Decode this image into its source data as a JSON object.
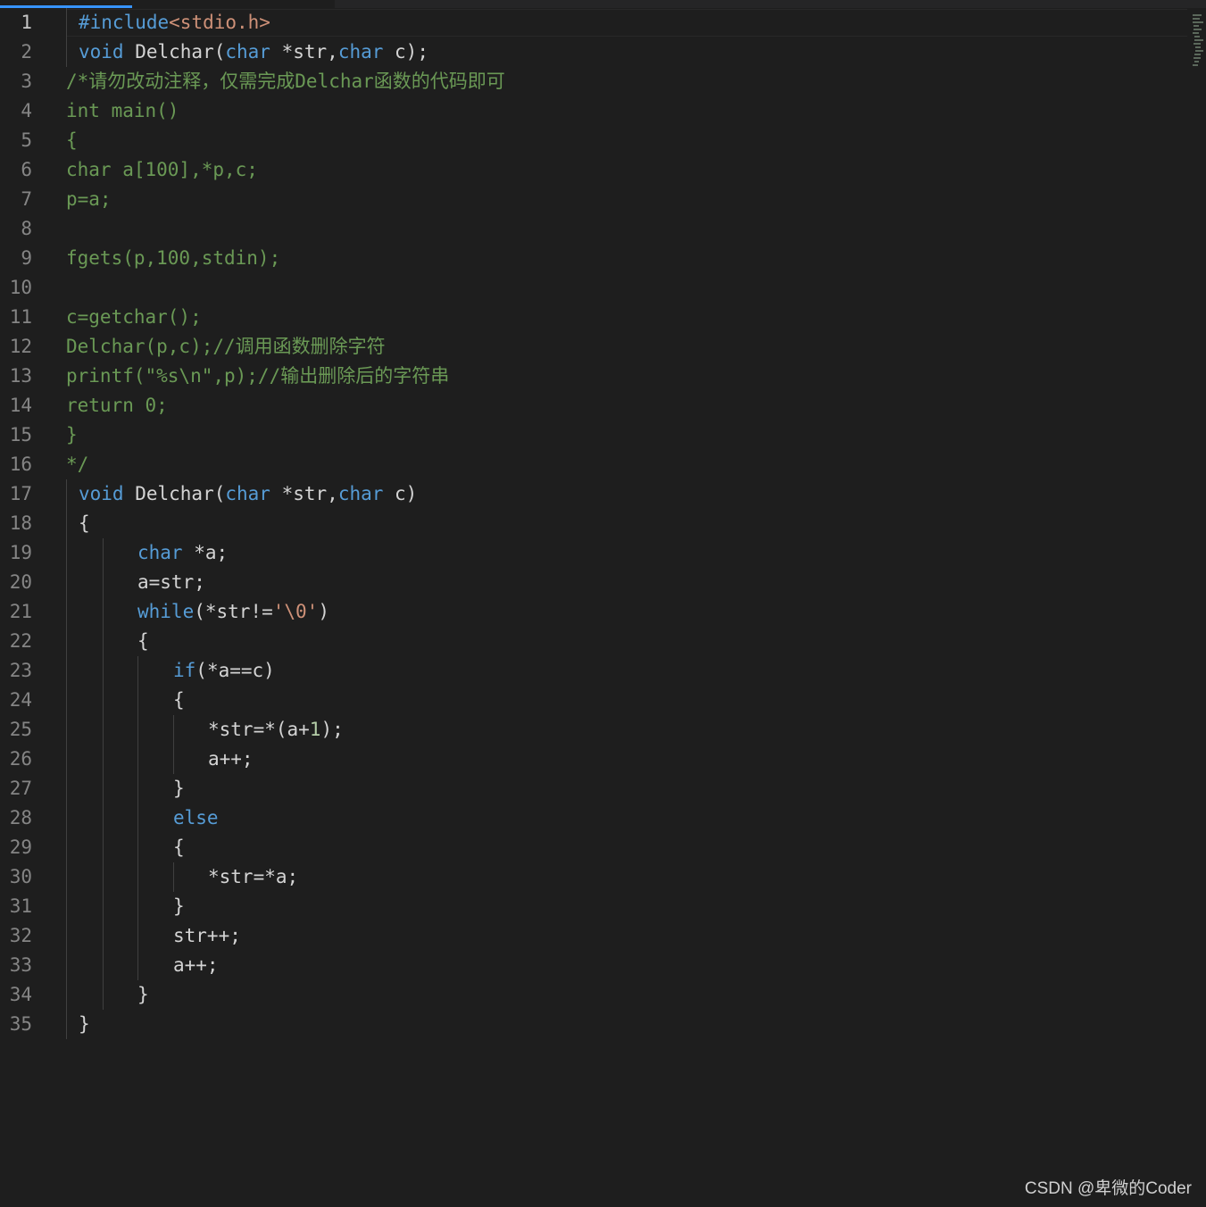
{
  "editor": {
    "active_line": 1,
    "colors": {
      "background": "#1e1e1e",
      "keyword": "#569cd6",
      "string": "#ce9178",
      "number": "#b5cea8",
      "comment": "#6a9955",
      "default": "#d4d4d4",
      "line_number": "#858585"
    },
    "lines": [
      {
        "n": "1",
        "segs": [
          {
            "c": "pp",
            "t": "#include"
          },
          {
            "c": "str",
            "t": "<stdio.h>"
          }
        ]
      },
      {
        "n": "2",
        "segs": [
          {
            "c": "kw",
            "t": "void"
          },
          {
            "c": "",
            "t": " Delchar("
          },
          {
            "c": "kw",
            "t": "char"
          },
          {
            "c": "",
            "t": " *str,"
          },
          {
            "c": "kw",
            "t": "char"
          },
          {
            "c": "",
            "t": " c);"
          }
        ]
      },
      {
        "n": "3",
        "segs": [
          {
            "c": "cm",
            "t": "/*请勿改动注释，仅需完成Delchar函数的代码即可"
          }
        ]
      },
      {
        "n": "4",
        "segs": [
          {
            "c": "cm",
            "t": "int main()"
          }
        ]
      },
      {
        "n": "5",
        "segs": [
          {
            "c": "cm",
            "t": "{"
          }
        ]
      },
      {
        "n": "6",
        "segs": [
          {
            "c": "cm",
            "t": "char a[100],*p,c;"
          }
        ]
      },
      {
        "n": "7",
        "segs": [
          {
            "c": "cm",
            "t": "p=a;"
          }
        ]
      },
      {
        "n": "8",
        "segs": []
      },
      {
        "n": "9",
        "segs": [
          {
            "c": "cm",
            "t": "fgets(p,100,stdin);"
          }
        ]
      },
      {
        "n": "10",
        "segs": []
      },
      {
        "n": "11",
        "segs": [
          {
            "c": "cm",
            "t": "c=getchar();"
          }
        ]
      },
      {
        "n": "12",
        "segs": [
          {
            "c": "cm",
            "t": "Delchar(p,c);//调用函数删除字符"
          }
        ]
      },
      {
        "n": "13",
        "segs": [
          {
            "c": "cm",
            "t": "printf(\"%s\\n\",p);//输出删除后的字符串"
          }
        ]
      },
      {
        "n": "14",
        "segs": [
          {
            "c": "cm",
            "t": "return 0;"
          }
        ]
      },
      {
        "n": "15",
        "segs": [
          {
            "c": "cm",
            "t": "}"
          }
        ]
      },
      {
        "n": "16",
        "segs": [
          {
            "c": "cm",
            "t": "*/"
          }
        ]
      },
      {
        "n": "17",
        "segs": [
          {
            "c": "kw",
            "t": "void"
          },
          {
            "c": "",
            "t": " Delchar("
          },
          {
            "c": "kw",
            "t": "char"
          },
          {
            "c": "",
            "t": " *str,"
          },
          {
            "c": "kw",
            "t": "char"
          },
          {
            "c": "",
            "t": " c)"
          }
        ]
      },
      {
        "n": "18",
        "segs": [
          {
            "c": "",
            "t": "{"
          }
        ]
      },
      {
        "n": "19",
        "segs": [
          {
            "c": "kw",
            "t": "char"
          },
          {
            "c": "",
            "t": " *a;"
          }
        ]
      },
      {
        "n": "20",
        "segs": [
          {
            "c": "",
            "t": "a=str;"
          }
        ]
      },
      {
        "n": "21",
        "segs": [
          {
            "c": "kw",
            "t": "while"
          },
          {
            "c": "",
            "t": "(*str!="
          },
          {
            "c": "str",
            "t": "'\\0'"
          },
          {
            "c": "",
            "t": ")"
          }
        ]
      },
      {
        "n": "22",
        "segs": [
          {
            "c": "",
            "t": "{"
          }
        ]
      },
      {
        "n": "23",
        "segs": [
          {
            "c": "kw",
            "t": "if"
          },
          {
            "c": "",
            "t": "(*a==c)"
          }
        ]
      },
      {
        "n": "24",
        "segs": [
          {
            "c": "",
            "t": "{"
          }
        ]
      },
      {
        "n": "25",
        "segs": [
          {
            "c": "",
            "t": "*str=*(a+"
          },
          {
            "c": "num",
            "t": "1"
          },
          {
            "c": "",
            "t": ");"
          }
        ]
      },
      {
        "n": "26",
        "segs": [
          {
            "c": "",
            "t": "a++;"
          }
        ]
      },
      {
        "n": "27",
        "segs": [
          {
            "c": "",
            "t": "}"
          }
        ]
      },
      {
        "n": "28",
        "segs": [
          {
            "c": "kw",
            "t": "else"
          }
        ]
      },
      {
        "n": "29",
        "segs": [
          {
            "c": "",
            "t": "{"
          }
        ]
      },
      {
        "n": "30",
        "segs": [
          {
            "c": "",
            "t": "*str=*a;"
          }
        ]
      },
      {
        "n": "31",
        "segs": [
          {
            "c": "",
            "t": "}"
          }
        ]
      },
      {
        "n": "32",
        "segs": [
          {
            "c": "",
            "t": "str++;"
          }
        ]
      },
      {
        "n": "33",
        "segs": [
          {
            "c": "",
            "t": "a++;"
          }
        ]
      },
      {
        "n": "34",
        "segs": [
          {
            "c": "",
            "t": "}"
          }
        ]
      },
      {
        "n": "35",
        "segs": [
          {
            "c": "",
            "t": "}"
          }
        ]
      }
    ]
  },
  "watermark": {
    "text": "CSDN @卑微的Coder"
  }
}
